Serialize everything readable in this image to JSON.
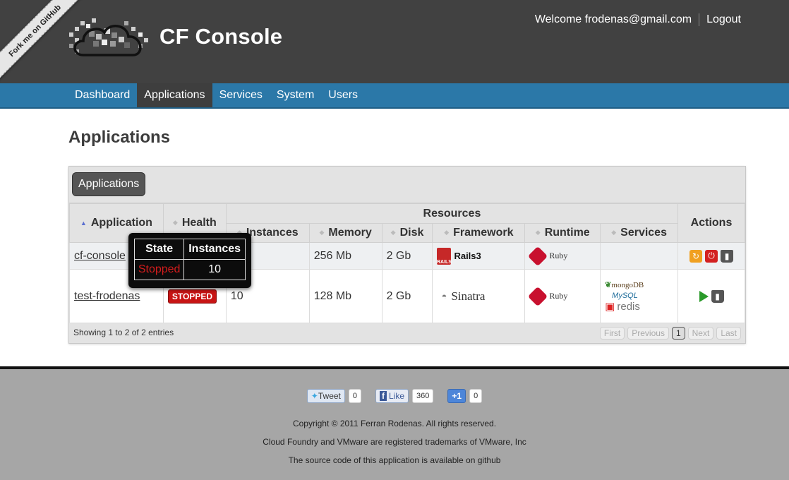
{
  "ribbon": "Fork me on GitHub",
  "brand": "CF Console",
  "user": {
    "welcome": "Welcome frodenas@gmail.com",
    "logout": "Logout"
  },
  "nav": [
    {
      "label": "Dashboard",
      "active": false
    },
    {
      "label": "Applications",
      "active": true
    },
    {
      "label": "Services",
      "active": false
    },
    {
      "label": "System",
      "active": false
    },
    {
      "label": "Users",
      "active": false
    }
  ],
  "page_title": "Applications",
  "panel_tab": "Applications",
  "table": {
    "headers": {
      "application": "Application",
      "health": "Health",
      "resources": "Resources",
      "instances": "Instances",
      "memory": "Memory",
      "disk": "Disk",
      "framework": "Framework",
      "runtime": "Runtime",
      "services": "Services",
      "actions": "Actions"
    },
    "rows": [
      {
        "application": "cf-console",
        "health": "",
        "instances": "",
        "memory": "256 Mb",
        "disk": "2 Gb",
        "framework": "Rails3",
        "runtime": "Ruby",
        "services": []
      },
      {
        "application": "test-frodenas",
        "health": "STOPPED",
        "instances": "10",
        "memory": "128 Mb",
        "disk": "2 Gb",
        "framework": "Sinatra",
        "runtime": "Ruby",
        "services": [
          "mongoDB",
          "MySQL",
          "redis"
        ]
      }
    ],
    "info": "Showing 1 to 2 of 2 entries",
    "pager": {
      "first": "First",
      "previous": "Previous",
      "page": "1",
      "next": "Next",
      "last": "Last"
    }
  },
  "tooltip": {
    "state_header": "State",
    "instances_header": "Instances",
    "state": "Stopped",
    "instances": "10"
  },
  "social": {
    "tweet": "Tweet",
    "tweet_count": "0",
    "like": "Like",
    "like_count": "360",
    "plusone": "+1",
    "plusone_count": "0"
  },
  "footer": {
    "copyright": "Copyright © 2011 Ferran Rodenas. All rights reserved.",
    "trademark": "Cloud Foundry and VMware are registered trademarks of VMware, Inc",
    "source": "The source code of this application is available on github"
  },
  "colors": {
    "nav": "#2b78a8",
    "header": "#414141",
    "footer": "#a6a6a6",
    "stopped": "#c81414"
  }
}
